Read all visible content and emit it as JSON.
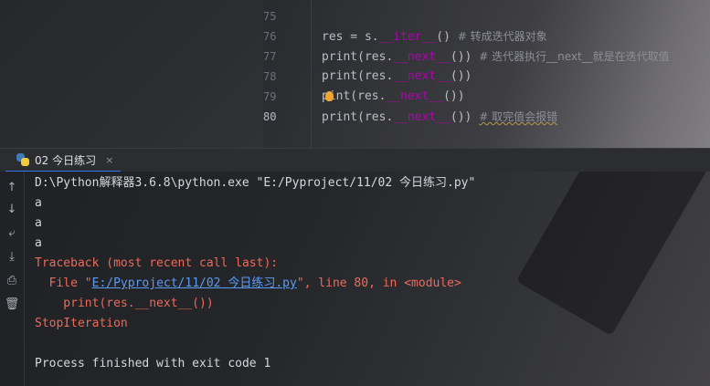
{
  "editor": {
    "lines": [
      {
        "number": "75",
        "code_before": "",
        "dunder": "",
        "code_after": "",
        "comment": ""
      },
      {
        "number": "76",
        "code_before": "res = s.",
        "dunder": "__iter__",
        "code_after": "()  ",
        "comment": "# 转成迭代器对象"
      },
      {
        "number": "77",
        "code_before": "print(res.",
        "dunder": "__next__",
        "code_after": "())  ",
        "comment": "# 迭代器执行__next__就是在迭代取值"
      },
      {
        "number": "78",
        "code_before": "print(res.",
        "dunder": "__next__",
        "code_after": "())",
        "comment": ""
      },
      {
        "number": "79",
        "code_before_a": "p",
        "code_before_b": "int(res.",
        "dunder": "__next__",
        "code_after": "())",
        "comment": ""
      },
      {
        "number": "80",
        "code_before": "print(res.",
        "dunder": "__next__",
        "code_after": "())  ",
        "comment": "# 取完值会报错"
      }
    ]
  },
  "run_panel": {
    "tab_label": "02 今日练习",
    "close_glyph": "×"
  },
  "toolbar_icons": [
    "arrow-up-icon",
    "arrow-down-icon",
    "soft-wrap-icon",
    "scroll-to-end-icon",
    "print-icon",
    "trash-icon"
  ],
  "console": {
    "command": "D:\\Python解释器3.6.8\\python.exe \"E:/Pyproject/11/02 今日练习.py\"",
    "outputs": [
      "a",
      "a",
      "a"
    ],
    "traceback_header": "Traceback (most recent call last):",
    "file_prefix": "  File \"",
    "file_link": "E:/Pyproject/11/02 今日练习.py",
    "file_suffix": "\", line 80, in <module>",
    "code_line": "    print(res.__next__())",
    "error": "StopIteration",
    "exit_message": "Process finished with exit code 1"
  },
  "colors": {
    "dunder": "#b200b2",
    "error": "#ef6a5a",
    "link": "#5c9cf5",
    "tab_accent": "#3574f0"
  }
}
